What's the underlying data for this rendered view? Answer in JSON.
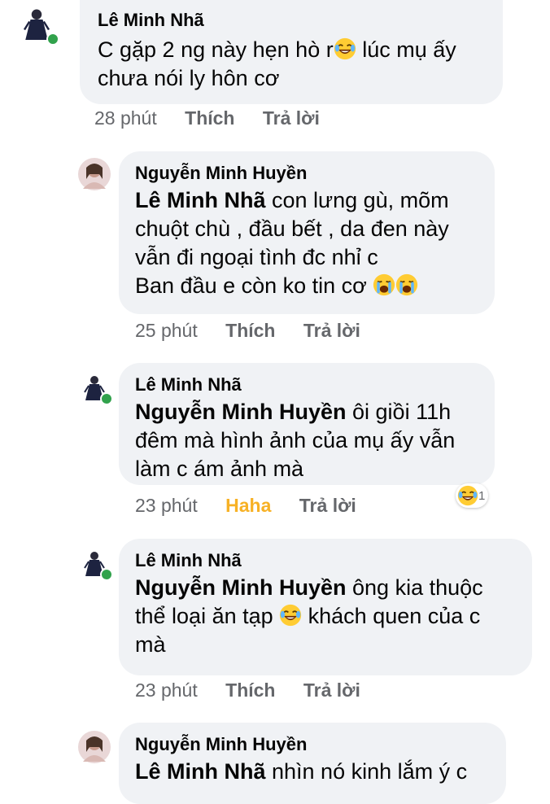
{
  "comments": [
    {
      "author": "Lê Minh Nhã",
      "lines": [
        "C gặp 2 ng này hẹn hò r",
        " lúc mụ ấy",
        "chưa nói ly hôn cơ"
      ],
      "time": "28 phút",
      "like": "Thích",
      "reply": "Trả lời",
      "online": true
    },
    {
      "author": "Nguyễn Minh Huyền",
      "mention": "Lê Minh Nhã",
      "lines": [
        " con lưng gù, mõm",
        "chuột chù , đầu bết , da đen này",
        "vẫn đi ngoại tình đc nhỉ c",
        "Ban đầu e còn ko tin cơ "
      ],
      "time": "25 phút",
      "like": "Thích",
      "reply": "Trả lời"
    },
    {
      "author": "Lê Minh Nhã",
      "mention": "Nguyễn Minh Huyền",
      "lines": [
        "  ôi giồi 11h",
        "đêm mà hình ảnh của mụ ấy vẫn",
        "làm c ám ảnh mà"
      ],
      "time": "23 phút",
      "like": "Haha",
      "reply": "Trả lời",
      "reaction_count": "1",
      "online": true
    },
    {
      "author": "Lê Minh Nhã",
      "mention": "Nguyễn Minh Huyền",
      "lines": [
        "  ông kia thuộc",
        "thể loại ăn tạp ",
        " khách quen của c",
        "mà"
      ],
      "time": "23 phút",
      "like": "Thích",
      "reply": "Trả lời",
      "online": true
    },
    {
      "author": "Nguyễn Minh Huyền",
      "mention": "Lê Minh Nhã",
      "lines": [
        " nhìn nó kinh lắm ý c"
      ]
    }
  ],
  "icons": {
    "laugh": "face-with-tears-of-joy-icon",
    "cry": "loudly-crying-face-icon",
    "haha_reaction": "haha-reaction-icon"
  },
  "colors": {
    "bubble": "#f0f2f5",
    "meta": "#65676b",
    "haha": "#f7b125",
    "online": "#31a24c"
  }
}
